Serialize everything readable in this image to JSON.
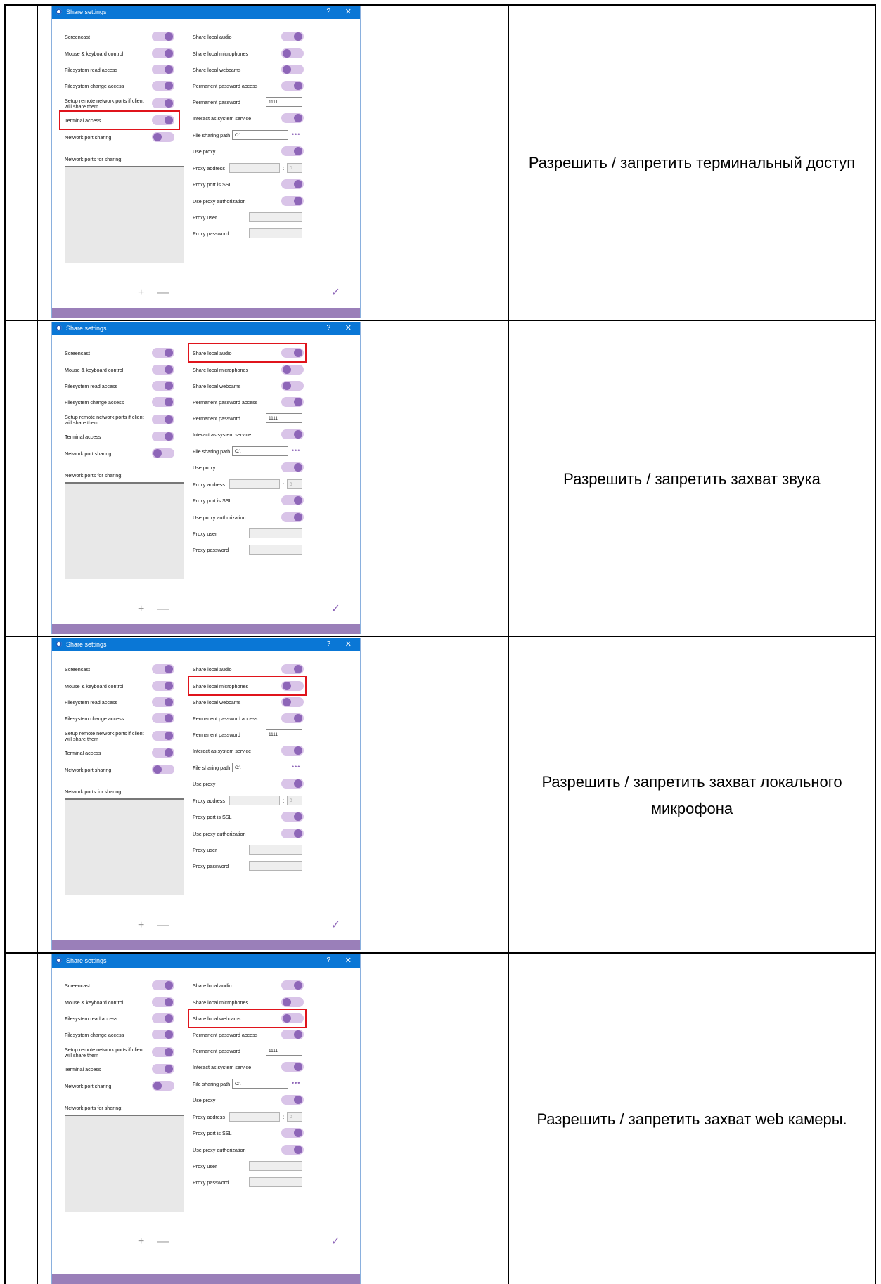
{
  "dialog": {
    "title": "Share settings",
    "help_glyph": "?",
    "close_glyph": "✕",
    "left_items": [
      {
        "label": "Screencast",
        "on": true
      },
      {
        "label": "Mouse & keyboard control",
        "on": true
      },
      {
        "label": "Filesystem read access",
        "on": true
      },
      {
        "label": "Filesystem change access",
        "on": true
      },
      {
        "label": "Setup remote network ports if client will share them",
        "on": true
      },
      {
        "label": "Terminal access",
        "on": true
      },
      {
        "label": "Network port sharing",
        "on": false
      }
    ],
    "ports_label": "Network ports for sharing:",
    "right_items": [
      {
        "label": "Share local audio",
        "type": "toggle",
        "on": true
      },
      {
        "label": "Share local microphones",
        "type": "toggle",
        "on": false
      },
      {
        "label": "Share local webcams",
        "type": "toggle",
        "on": false
      },
      {
        "label": "Permanent password access",
        "type": "toggle",
        "on": true
      },
      {
        "label": "Permanent password",
        "type": "input",
        "value": "1111"
      },
      {
        "label": "Interact as system service",
        "type": "toggle",
        "on": true
      },
      {
        "label": "File sharing path",
        "type": "path",
        "value": "C:\\"
      },
      {
        "label": "Use proxy",
        "type": "toggle",
        "on": true
      },
      {
        "label": "Proxy address",
        "type": "proxy",
        "value": "",
        "port": "0"
      },
      {
        "label": "Proxy port is SSL",
        "type": "toggle",
        "on": true
      },
      {
        "label": "Use proxy authorization",
        "type": "toggle",
        "on": true
      },
      {
        "label": "Proxy user",
        "type": "input_dis",
        "value": ""
      },
      {
        "label": "Proxy password",
        "type": "input_dis",
        "value": ""
      }
    ],
    "plus_glyph": "+",
    "minus_glyph": "—",
    "ok_glyph": "✓",
    "more_glyph": "•••",
    "colon": ":"
  },
  "rows": [
    {
      "description": "Разрешить / запретить терминальный доступ",
      "highlight": "Terminal access"
    },
    {
      "description": "Разрешить / запретить захват звука",
      "highlight": "Share local audio"
    },
    {
      "description": "Разрешить / запретить захват локального микрофона",
      "highlight": "Share local microphones"
    },
    {
      "description": "Разрешить / запретить захват web камеры.",
      "highlight": "Share local webcams"
    }
  ],
  "colors": {
    "accent": "#8e66b8",
    "titlebar": "#0a77d6",
    "highlight": "#e0141c"
  }
}
